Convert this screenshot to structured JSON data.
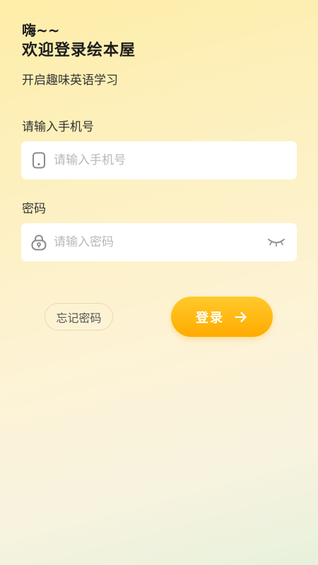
{
  "header": {
    "greeting": "嗨~~",
    "welcome": "欢迎登录绘本屋",
    "subtitle": "开启趣味英语学习"
  },
  "phone_field": {
    "label": "请输入手机号",
    "placeholder": "请输入手机号",
    "value": "",
    "icon": "phone-icon"
  },
  "password_field": {
    "label": "密码",
    "placeholder": "请输入密码",
    "value": "",
    "icon": "lock-icon",
    "toggle_icon": "eye-closed-icon"
  },
  "actions": {
    "forgot_label": "忘记密码",
    "login_label": "登录",
    "login_icon": "arrow-right-icon"
  },
  "colors": {
    "accent": "#ffb400",
    "icon_gray": "#8a8a8a"
  }
}
